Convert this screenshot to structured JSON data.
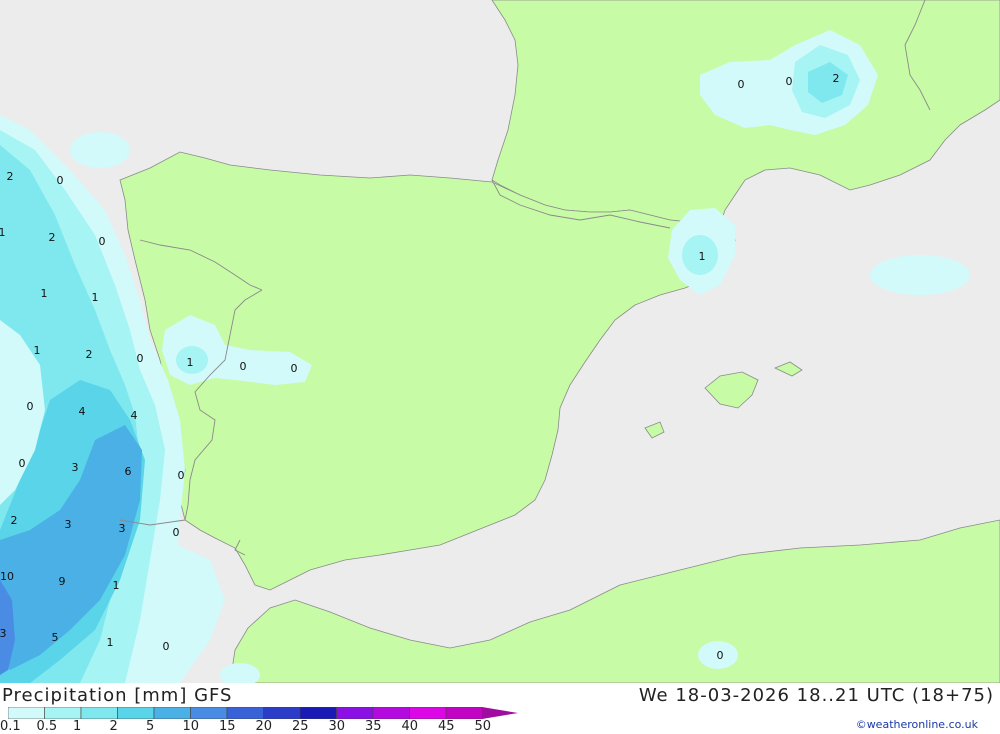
{
  "footer": {
    "title": "Precipitation [mm] GFS",
    "valid_time": "We 18-03-2026 18..21 UTC (18+75)",
    "credit": "©weatheronline.co.uk"
  },
  "legend": {
    "labels": [
      "0.1",
      "0.5",
      "1",
      "2",
      "5",
      "10",
      "15",
      "20",
      "25",
      "30",
      "35",
      "40",
      "45",
      "50"
    ],
    "colors": [
      "#d2fafa",
      "#a6f4f4",
      "#7fe8ee",
      "#5ad4e8",
      "#4ab0e6",
      "#4a8ce4",
      "#3a62d8",
      "#2a3cc8",
      "#1a1ab4",
      "#8a10e6",
      "#b40ae0",
      "#dc06e6",
      "#c404c4",
      "#a00ca0"
    ]
  },
  "map": {
    "colors": {
      "sea": "#ececec",
      "land": "#c8fba6",
      "border": "#8a8a8a"
    },
    "values": [
      {
        "v": "2"
      },
      {
        "v": "0"
      },
      {
        "v": "1"
      },
      {
        "v": "2"
      },
      {
        "v": "0"
      },
      {
        "v": "1"
      },
      {
        "v": "1"
      },
      {
        "v": "1"
      },
      {
        "v": "2"
      },
      {
        "v": "0"
      },
      {
        "v": "0"
      },
      {
        "v": "4"
      },
      {
        "v": "4"
      },
      {
        "v": "0"
      },
      {
        "v": "3"
      },
      {
        "v": "6"
      },
      {
        "v": "0"
      },
      {
        "v": "2"
      },
      {
        "v": "3"
      },
      {
        "v": "3"
      },
      {
        "v": "0"
      },
      {
        "v": "10"
      },
      {
        "v": "9"
      },
      {
        "v": "1"
      },
      {
        "v": "3"
      },
      {
        "v": "5"
      },
      {
        "v": "1"
      },
      {
        "v": "0"
      },
      {
        "v": "1"
      },
      {
        "v": "0"
      },
      {
        "v": "0"
      },
      {
        "v": "0"
      },
      {
        "v": "0"
      },
      {
        "v": "2"
      },
      {
        "v": "1"
      },
      {
        "v": "0"
      }
    ]
  }
}
